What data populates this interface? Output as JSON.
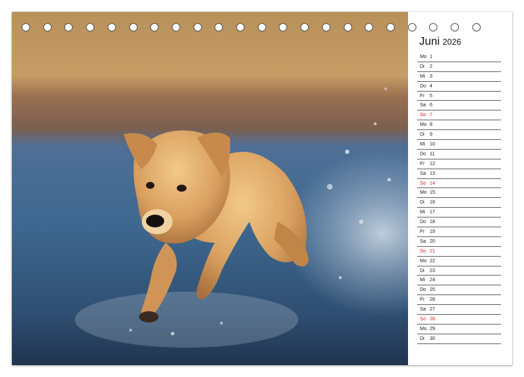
{
  "calendar": {
    "month": "Juni",
    "year": "2026",
    "days": [
      {
        "wd": "Mo",
        "num": "1",
        "sun": false
      },
      {
        "wd": "Di",
        "num": "2",
        "sun": false
      },
      {
        "wd": "Mi",
        "num": "3",
        "sun": false
      },
      {
        "wd": "Do",
        "num": "4",
        "sun": false
      },
      {
        "wd": "Fr",
        "num": "5",
        "sun": false
      },
      {
        "wd": "Sa",
        "num": "6",
        "sun": false
      },
      {
        "wd": "So",
        "num": "7",
        "sun": true
      },
      {
        "wd": "Mo",
        "num": "8",
        "sun": false
      },
      {
        "wd": "Di",
        "num": "9",
        "sun": false
      },
      {
        "wd": "Mi",
        "num": "10",
        "sun": false
      },
      {
        "wd": "Do",
        "num": "11",
        "sun": false
      },
      {
        "wd": "Fr",
        "num": "12",
        "sun": false
      },
      {
        "wd": "Sa",
        "num": "13",
        "sun": false
      },
      {
        "wd": "So",
        "num": "14",
        "sun": true
      },
      {
        "wd": "Mo",
        "num": "15",
        "sun": false
      },
      {
        "wd": "Di",
        "num": "16",
        "sun": false
      },
      {
        "wd": "Mi",
        "num": "17",
        "sun": false
      },
      {
        "wd": "Do",
        "num": "18",
        "sun": false
      },
      {
        "wd": "Fr",
        "num": "19",
        "sun": false
      },
      {
        "wd": "Sa",
        "num": "20",
        "sun": false
      },
      {
        "wd": "So",
        "num": "21",
        "sun": true
      },
      {
        "wd": "Mo",
        "num": "22",
        "sun": false
      },
      {
        "wd": "Di",
        "num": "23",
        "sun": false
      },
      {
        "wd": "Mi",
        "num": "24",
        "sun": false
      },
      {
        "wd": "Do",
        "num": "25",
        "sun": false
      },
      {
        "wd": "Fr",
        "num": "26",
        "sun": false
      },
      {
        "wd": "Sa",
        "num": "27",
        "sun": false
      },
      {
        "wd": "So",
        "num": "28",
        "sun": true
      },
      {
        "wd": "Mo",
        "num": "29",
        "sun": false
      },
      {
        "wd": "Di",
        "num": "30",
        "sun": false
      }
    ]
  },
  "colors": {
    "sunday": "#d22222",
    "weekday": "#222222",
    "rule": "#666666"
  },
  "binding": {
    "hole_count": 22
  },
  "photo": {
    "subject_icon": "dog-photo"
  }
}
